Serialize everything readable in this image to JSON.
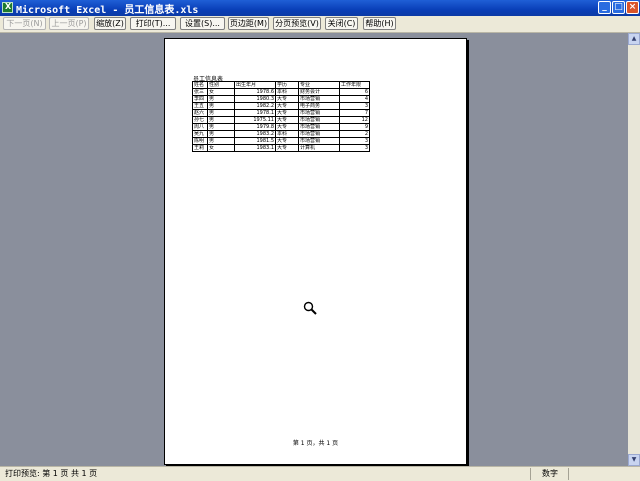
{
  "window": {
    "title": "Microsoft Excel - 员工信息表.xls",
    "app_icon": "excel-icon",
    "controls": [
      "_",
      "□",
      "×"
    ]
  },
  "toolbar": {
    "next_page": "下一页(N)",
    "prev_page": "上一页(P)",
    "zoom": "缩放(Z)",
    "print": "打印(T)...",
    "setup": "设置(S)...",
    "margins": "页边距(M)",
    "page_break_preview": "分页预览(V)",
    "close": "关闭(C)",
    "help": "帮助(H)"
  },
  "sheet": {
    "title": "员工信息表",
    "headers": [
      "姓名",
      "性别",
      "出生年月",
      "学历",
      "专业",
      "工作年限"
    ],
    "rows": [
      [
        "张三",
        "女",
        "1978.6",
        "本科",
        "财务会计",
        "6"
      ],
      [
        "李四",
        "男",
        "1980.3",
        "大专",
        "市场营销",
        "4"
      ],
      [
        "王五",
        "男",
        "1982.2",
        "大专",
        "电子商务",
        "3"
      ],
      [
        "赵六",
        "男",
        "1978.1",
        "大专",
        "市场营销",
        "7"
      ],
      [
        "孙七",
        "男",
        "1975.11",
        "大专",
        "市场营销",
        "12"
      ],
      [
        "周八",
        "男",
        "1979.8",
        "大专",
        "市场营销",
        "9"
      ],
      [
        "吴九",
        "男",
        "1983.2",
        "本科",
        "市场营销",
        "2"
      ],
      [
        "陈明",
        "男",
        "1981.5",
        "大专",
        "市场营销",
        "3"
      ],
      [
        "王莉",
        "女",
        "1983.1",
        "大专",
        "计算机",
        "3"
      ]
    ],
    "footer": "第 1 页，共 1 页"
  },
  "status": {
    "left": "打印预览: 第 1 页  共 1 页",
    "mode": "数字"
  },
  "colors": {
    "titlebar": "#0a3fb8",
    "workspace": "#8a8f9c",
    "chrome": "#ece9d8"
  }
}
